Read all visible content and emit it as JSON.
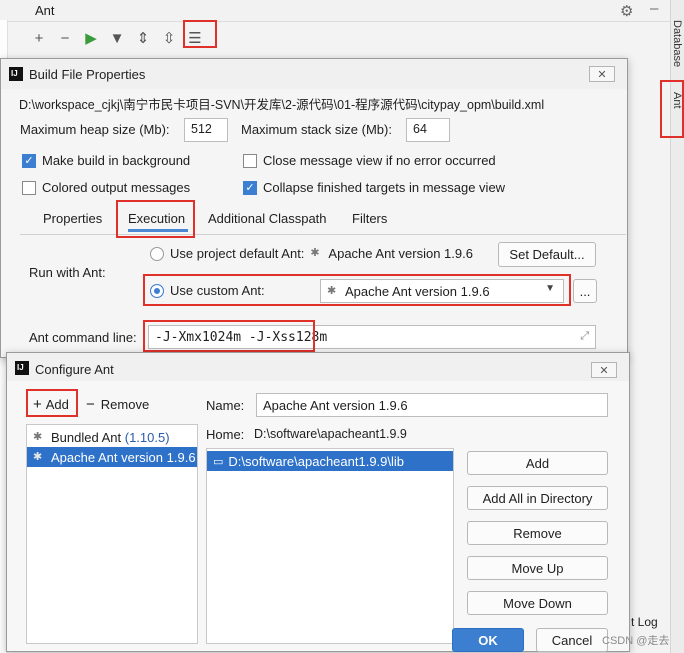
{
  "ant_window": {
    "title": "Ant",
    "icons": [
      "add-icon",
      "remove-icon",
      "run-icon",
      "filter-icon",
      "expand-all-icon",
      "collapse-all-icon",
      "properties-icon",
      "settings-icon",
      "minimize-icon"
    ],
    "side_tabs": [
      "Database",
      "Ant"
    ]
  },
  "build_file_dialog": {
    "title": "Build File Properties",
    "path": "D:\\workspace_cjkj\\南宁市民卡项目-SVN\\开发库\\2-源代码\\01-程序源代码\\citypay_opm\\build.xml",
    "max_heap_label": "Maximum heap size (Mb):",
    "max_heap_value": "512",
    "max_stack_label": "Maximum stack size (Mb):",
    "max_stack_value": "64",
    "make_background": "Make build in background",
    "close_message_view": "Close message view if no error occurred",
    "colored_output": "Colored output messages",
    "collapse_finished": "Collapse finished targets in message view",
    "tabs": [
      "Properties",
      "Execution",
      "Additional Classpath",
      "Filters"
    ],
    "run_with_ant_label": "Run with Ant:",
    "use_project_default": "Use project default Ant:",
    "default_ant_version": "Apache Ant version 1.9.6",
    "set_default_button": "Set Default...",
    "use_custom": "Use custom Ant:",
    "custom_ant_version": "Apache Ant version 1.9.6",
    "ellipsis_button": "...",
    "ant_command_label": "Ant command line:",
    "ant_command_value": "-J-Xmx1024m -J-Xss128m"
  },
  "configure_ant_dialog": {
    "title": "Configure Ant",
    "add_button": "Add",
    "remove_button": "Remove",
    "ant_list": [
      {
        "name": "Bundled Ant",
        "version": "(1.10.5)"
      },
      {
        "name": "Apache Ant version 1.9.6",
        "version": ""
      }
    ],
    "name_label": "Name:",
    "name_value": "Apache Ant version 1.9.6",
    "home_label": "Home:",
    "home_value": "D:\\software\\apacheant1.9.9",
    "classpath_items": [
      "D:\\software\\apacheant1.9.9\\lib"
    ],
    "side_buttons": [
      "Add",
      "Add All in Directory",
      "Remove",
      "Move Up",
      "Move Down"
    ],
    "ok_button": "OK",
    "cancel_button": "Cancel"
  },
  "background_text": {
    "event_log": "t Log",
    "watermark": "CSDN @走去"
  },
  "colors": {
    "accent": "#3c7fd1",
    "highlight_red": "#e0302a",
    "selection": "#2e71c9"
  }
}
